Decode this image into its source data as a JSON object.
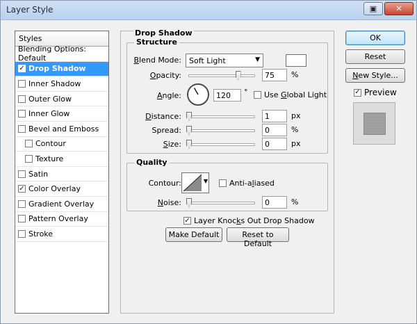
{
  "window": {
    "title": "Layer Style",
    "help_icon": "help-icon",
    "close_icon": "close-icon"
  },
  "styles_panel": {
    "header": "Styles",
    "items": [
      {
        "label": "Blending Options: Default",
        "checkbox": false,
        "checked": false,
        "indent": false,
        "selected": false
      },
      {
        "label": "Drop Shadow",
        "checkbox": true,
        "checked": true,
        "indent": false,
        "selected": true
      },
      {
        "label": "Inner Shadow",
        "checkbox": true,
        "checked": false,
        "indent": false,
        "selected": false
      },
      {
        "label": "Outer Glow",
        "checkbox": true,
        "checked": false,
        "indent": false,
        "selected": false
      },
      {
        "label": "Inner Glow",
        "checkbox": true,
        "checked": false,
        "indent": false,
        "selected": false
      },
      {
        "label": "Bevel and Emboss",
        "checkbox": true,
        "checked": false,
        "indent": false,
        "selected": false
      },
      {
        "label": "Contour",
        "checkbox": true,
        "checked": false,
        "indent": true,
        "selected": false
      },
      {
        "label": "Texture",
        "checkbox": true,
        "checked": false,
        "indent": true,
        "selected": false
      },
      {
        "label": "Satin",
        "checkbox": true,
        "checked": false,
        "indent": false,
        "selected": false
      },
      {
        "label": "Color Overlay",
        "checkbox": true,
        "checked": true,
        "indent": false,
        "selected": false
      },
      {
        "label": "Gradient Overlay",
        "checkbox": true,
        "checked": false,
        "indent": false,
        "selected": false
      },
      {
        "label": "Pattern Overlay",
        "checkbox": true,
        "checked": false,
        "indent": false,
        "selected": false
      },
      {
        "label": "Stroke",
        "checkbox": true,
        "checked": false,
        "indent": false,
        "selected": false
      }
    ]
  },
  "drop_shadow": {
    "title": "Drop Shadow",
    "structure": {
      "title": "Structure",
      "blend_mode_label": "lend Mode:",
      "blend_mode_accel": "B",
      "blend_mode_value": "Soft Light",
      "swatch_color": "#ffffff",
      "opacity_label": "pacity:",
      "opacity_accel": "O",
      "opacity_value": "75",
      "opacity_fraction": 0.75,
      "opacity_unit": "%",
      "angle_label": "ngle:",
      "angle_accel": "A",
      "angle_value": "120",
      "angle_degrees": 120,
      "angle_unit": "°",
      "global_light_label": "Use ",
      "global_light_accel": "G",
      "global_light_rest": "lobal Light",
      "global_light_checked": false,
      "distance_label": "istance:",
      "distance_accel": "D",
      "distance_value": "1",
      "distance_unit": "px",
      "spread_label": "read:",
      "spread_prefix": "Sp",
      "spread_value": "0",
      "spread_unit": "%",
      "size_label": "ize:",
      "size_accel": "S",
      "size_value": "0",
      "size_unit": "px"
    },
    "quality": {
      "title": "Quality",
      "contour_label": "Contour:",
      "anti_aliased_label": "Anti-a",
      "anti_aliased_accel": "l",
      "anti_aliased_rest": "iased",
      "anti_aliased_checked": false,
      "noise_label": "oise:",
      "noise_accel": "N",
      "noise_value": "0",
      "noise_unit": "%"
    },
    "knockout_label": "Layer Knoc",
    "knockout_accel": "k",
    "knockout_rest": "s Out Drop Shadow",
    "knockout_checked": true,
    "make_default": "Make Default",
    "reset_default": "Reset to Default"
  },
  "buttons": {
    "ok": "OK",
    "reset": "Reset",
    "new_style_accel": "N",
    "new_style_rest": "ew Style...",
    "preview_label": "Preview",
    "preview_checked": true
  }
}
